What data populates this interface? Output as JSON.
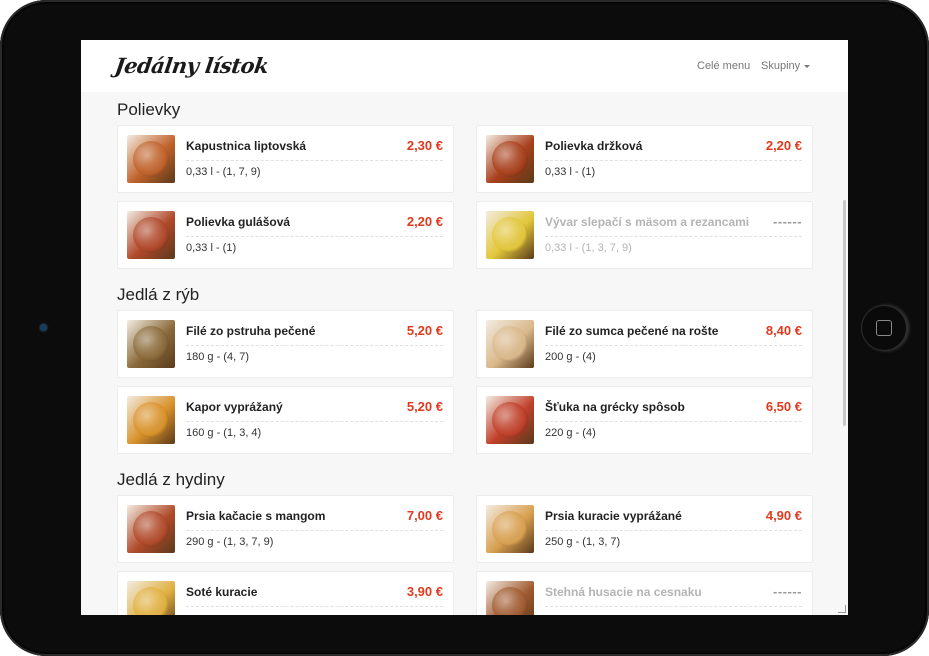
{
  "navbar": {
    "brand": "Jedálny lístok",
    "links": {
      "full_menu": "Celé menu",
      "groups": "Skupiny"
    }
  },
  "colors": {
    "price": "#e03a1e",
    "unavailable_text": "#b4b4b4",
    "device_frame": "#0c0c0c"
  },
  "sections": [
    {
      "title": "Polievky",
      "items": [
        {
          "name": "Kapustnica liptovská",
          "price": "2,30 €",
          "desc": "0,33 l - (1, 7, 9)",
          "thumb": "#c0622a",
          "available": true
        },
        {
          "name": "Polievka držková",
          "price": "2,20 €",
          "desc": "0,33 l - (1)",
          "thumb": "#a8401c",
          "available": true
        },
        {
          "name": "Polievka gulášová",
          "price": "2,20 €",
          "desc": "0,33 l - (1)",
          "thumb": "#b0482a",
          "available": true
        },
        {
          "name": "Vývar slepačí s mäsom a rezancami",
          "price": "------",
          "desc": "0,33 l - (1, 3, 7, 9)",
          "thumb": "#e2c63a",
          "available": false
        }
      ]
    },
    {
      "title": "Jedlá z rýb",
      "items": [
        {
          "name": "Filé zo pstruha pečené",
          "price": "5,20 €",
          "desc": "180 g - (4, 7)",
          "thumb": "#8a6a3a",
          "available": true
        },
        {
          "name": "Filé zo sumca pečené na rošte",
          "price": "8,40 €",
          "desc": "200 g - (4)",
          "thumb": "#d9b88a",
          "available": true
        },
        {
          "name": "Kapor vyprážaný",
          "price": "5,20 €",
          "desc": "160 g - (1, 3, 4)",
          "thumb": "#d9922a",
          "available": true
        },
        {
          "name": "Šťuka na grécky spôsob",
          "price": "6,50 €",
          "desc": "220 g - (4)",
          "thumb": "#c0402a",
          "available": true
        }
      ]
    },
    {
      "title": "Jedlá z hydiny",
      "items": [
        {
          "name": "Prsia kačacie s mangom",
          "price": "7,00 €",
          "desc": "290 g - (1, 3, 7, 9)",
          "thumb": "#b04a2a",
          "available": true
        },
        {
          "name": "Prsia kuracie vyprážané",
          "price": "4,90 €",
          "desc": "250 g - (1, 3, 7)",
          "thumb": "#d8a050",
          "available": true
        },
        {
          "name": "Soté kuracie",
          "price": "3,90 €",
          "desc": "",
          "thumb": "#e0b040",
          "available": true
        },
        {
          "name": "Stehná husacie na cesnaku",
          "price": "------",
          "desc": "",
          "thumb": "#a05a30",
          "available": false
        }
      ]
    }
  ]
}
